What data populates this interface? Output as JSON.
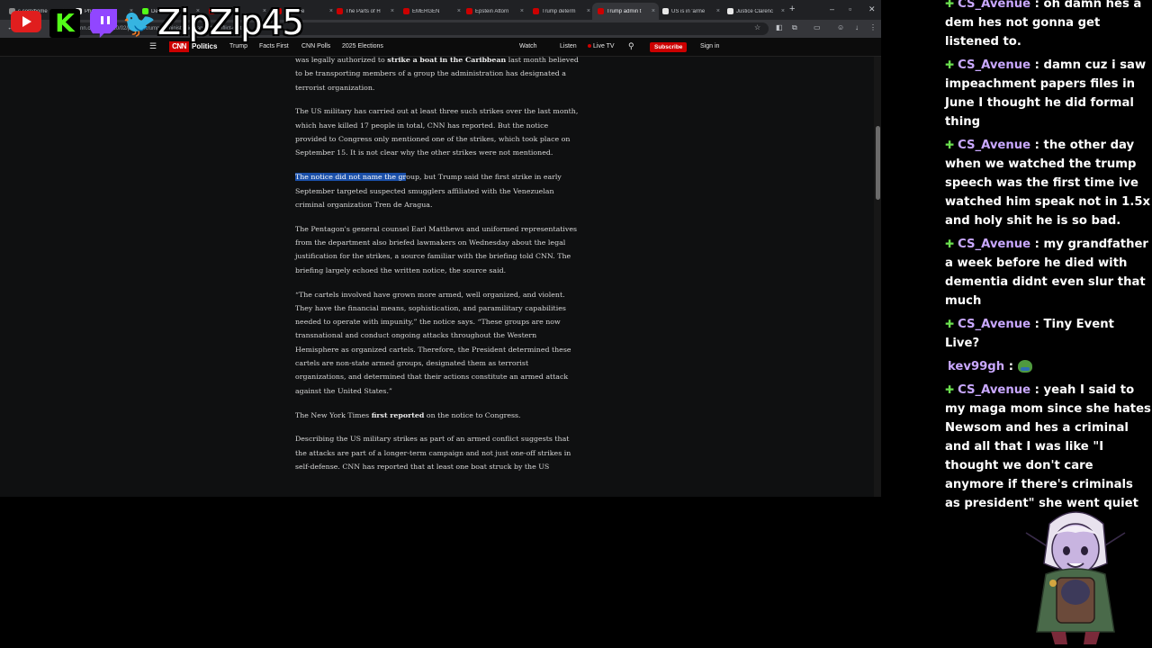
{
  "browser": {
    "tabs": [
      {
        "label": "s.com/home",
        "favicon_color": "#8a8a8a"
      },
      {
        "label": "Phoenix",
        "favicon_color": "#e8e8e8"
      },
      {
        "label": "Del",
        "favicon_color": "#53fc18"
      },
      {
        "label": "deci",
        "favicon_color": "#cc0000"
      },
      {
        "label": "says the",
        "favicon_color": "#cc0000"
      },
      {
        "label": "The Parts of H",
        "favicon_color": "#cc0000"
      },
      {
        "label": "EMERGEN",
        "favicon_color": "#cc0000"
      },
      {
        "label": "Epstein Attorn",
        "favicon_color": "#cc0000"
      },
      {
        "label": "Trump determ",
        "favicon_color": "#cc0000"
      },
      {
        "label": "Trump admin t",
        "favicon_color": "#cc0000"
      },
      {
        "label": "US is in 'arme",
        "favicon_color": "#e8e8e8"
      },
      {
        "label": "Justice Clarenc",
        "favicon_color": "#e8e8e8"
      }
    ],
    "url": "cnn.com/2025/10/02/politics/trump-administration-armed-conflict-cartels"
  },
  "nav": {
    "section": "Politics",
    "logo": "CNN",
    "items": [
      "Trump",
      "Facts First",
      "CNN Polls",
      "2025 Elections"
    ],
    "watch": "Watch",
    "listen": "Listen",
    "live_tv": "Live TV",
    "subscribe": "Subscribe",
    "sign_in": "Sign in"
  },
  "article": {
    "p0_pre": "was legally authorized to ",
    "p0_bold": "strike a boat in the Caribbean",
    "p0_post": " last month believed to be transporting members of a group the administration has designated a terrorist organization.",
    "p1": "The US military has carried out at least three such strikes over the last month, which have killed 17 people in total, CNN has reported. But the notice provided to Congress only mentioned one of the strikes, which took place on September 15. It is not clear why the other strikes were not mentioned.",
    "p2_highlight": "The notice did not name the gr",
    "p2_rest": "oup, but Trump said the first strike in early September targeted suspected smugglers affiliated with the Venezuelan criminal organization Tren de Aragua.",
    "p3": "The Pentagon's general counsel Earl Matthews and uniformed representatives from the department also briefed lawmakers on Wednesday about the legal justification for the strikes, a source familiar with the briefing told CNN. The briefing largely echoed the written notice, the source said.",
    "p4": "“The cartels involved have grown more armed, well organized, and violent. They have the financial means, sophistication, and paramilitary capabilities needed to operate with impunity,” the notice says. “These groups are now transnational and conduct ongoing attacks throughout the Western Hemisphere as organized cartels. Therefore, the President determined these cartels are non-state armed groups, designated them as terrorist organizations, and determined that their actions constitute an armed attack against the United States.”",
    "p5_pre": "The New York Times ",
    "p5_bold": "first reported",
    "p5_post": " on the notice to Congress.",
    "p6": "Describing the US military strikes as part of an armed conflict suggests that the attacks are part of a longer-term campaign and not just one-off strikes in self-defense. CNN has reported that at least one boat struck by the US"
  },
  "overlay": {
    "handle": "ZipZip45"
  },
  "chat": [
    {
      "user": "CS_Avenue",
      "text": "oh damn hes a dem hes not gonna get listened to.",
      "badge": true
    },
    {
      "user": "CS_Avenue",
      "text": "damn cuz i saw impeachment papers files in June I thought he did formal thing",
      "badge": true
    },
    {
      "user": "CS_Avenue",
      "text": "the other day when we watched the trump speech was the first time ive watched him speak not in 1.5x and holy shit he is so bad.",
      "badge": true
    },
    {
      "user": "CS_Avenue",
      "text": "my grandfather a week before he died with dementia didnt even slur that much",
      "badge": true
    },
    {
      "user": "CS_Avenue",
      "text": "Tiny Event Live?",
      "badge": true
    },
    {
      "user": "kev99gh",
      "text": "",
      "badge": false,
      "emote": "frog-emote"
    },
    {
      "user": "CS_Avenue",
      "text": "yeah I said to my maga mom since she hates Newsom and hes a criminal and all that I was like \"I thought we don't care anymore if there's criminals as president\" she went quiet",
      "badge": true
    }
  ],
  "colors": {
    "highlight": "#1a4fa8",
    "cnn_red": "#cc0000",
    "chat_user": "#c9a8ff",
    "badge": "#6be04f"
  }
}
